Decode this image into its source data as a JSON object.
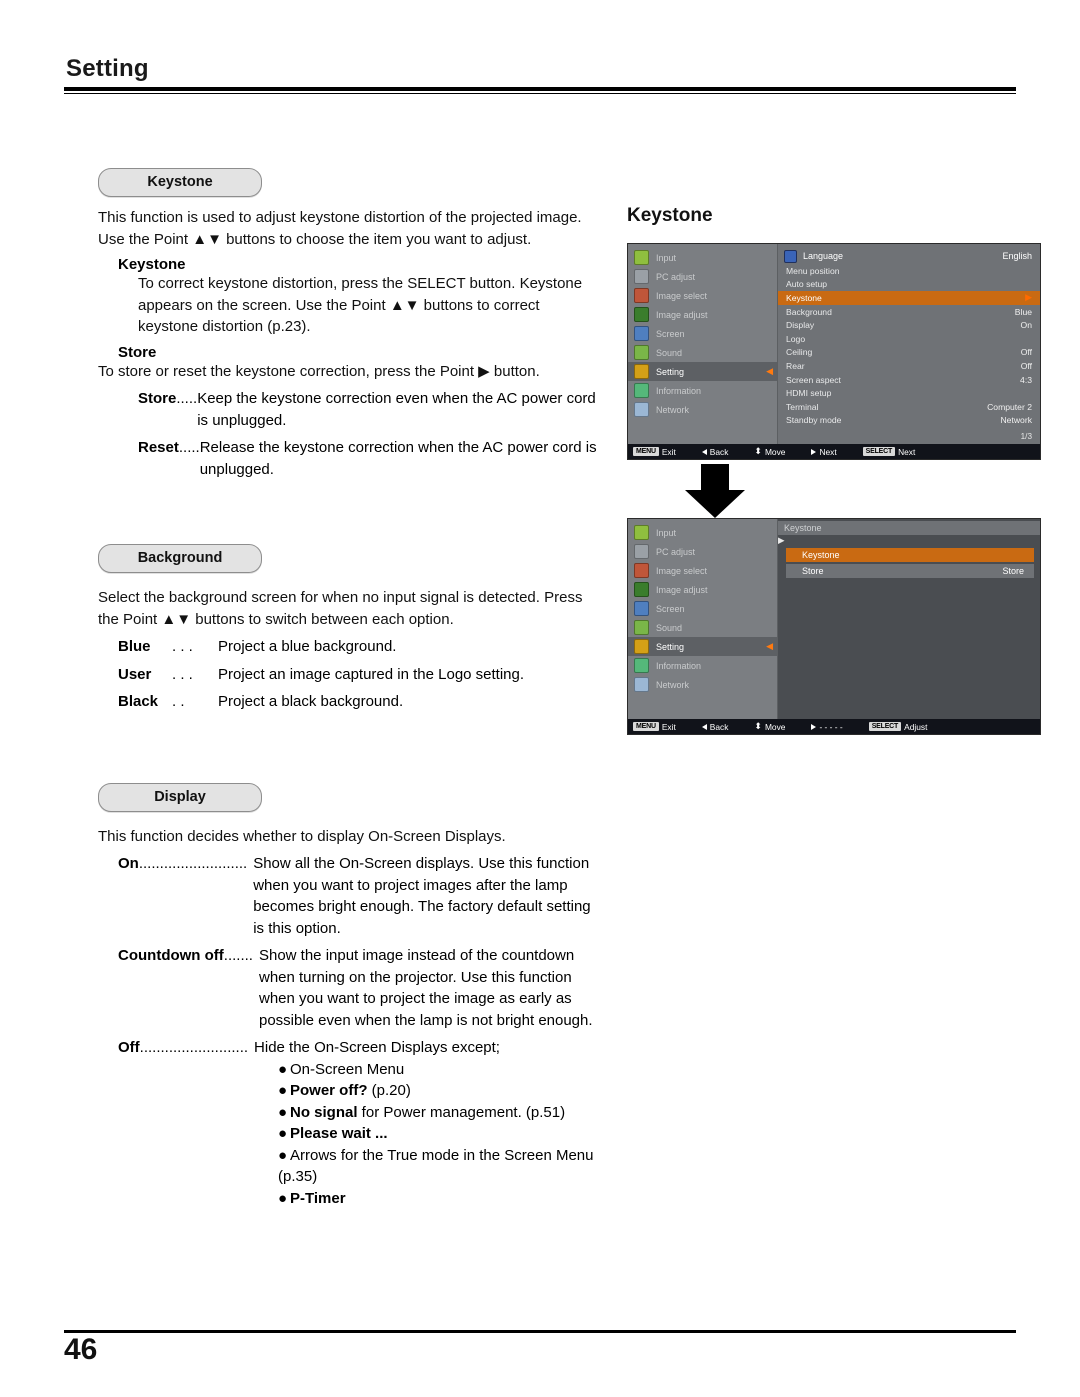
{
  "page": {
    "section_title": "Setting",
    "page_number": "46"
  },
  "keystone": {
    "pill": "Keystone",
    "intro": "This function is used to adjust keystone distortion of the projected image. Use the Point ▲▼ buttons to choose the item you want to adjust.",
    "sub1_title": "Keystone",
    "sub1_text": "To correct keystone distortion, press the SELECT button. Keystone appears on the screen. Use the Point ▲▼ buttons to correct keystone distortion (p.23).",
    "sub2_title": "Store",
    "sub2_text": "To store or reset the keystone correction, press the Point ▶ button.",
    "items": [
      {
        "term": "Store",
        "dots": " .....",
        "desc": "Keep the keystone correction even when the AC power cord is unplugged."
      },
      {
        "term": "Reset",
        "dots": ".....",
        "desc": "Release the keystone correction when the AC power cord is unplugged."
      }
    ]
  },
  "background": {
    "pill": "Background",
    "intro": "Select the background screen for when no input signal is detected. Press the Point ▲▼ buttons to switch between each option.",
    "items": [
      {
        "term": "Blue",
        "dots": " . . .",
        "desc": "Project a blue background."
      },
      {
        "term": "User",
        "dots": " . . .",
        "desc": "Project an image captured in the Logo setting."
      },
      {
        "term": "Black",
        "dots": " . .",
        "desc": "Project a black background."
      }
    ]
  },
  "display": {
    "pill": "Display",
    "intro": "This function decides whether to display On-Screen Displays.",
    "items": [
      {
        "term": "On",
        "dots": " ..........................",
        "desc": "Show all the On-Screen displays. Use this function when you want to project images after the lamp becomes bright enough. The factory default setting is this option."
      },
      {
        "term": "Countdown off",
        "dots": " .......",
        "desc": "Show the input image instead of the countdown when turning on the projector. Use this function when you want to project the image as early as possible even when the lamp is not bright enough."
      },
      {
        "term": "Off",
        "dots": " ..........................",
        "desc": "Hide the On-Screen Displays except;"
      }
    ],
    "off_bullets": [
      {
        "text": "On-Screen Menu",
        "bold": ""
      },
      {
        "text": " (p.20)",
        "bold": "Power off?"
      },
      {
        "text": " for Power management. (p.51)",
        "bold": "No signal"
      },
      {
        "text": "",
        "bold": "Please wait ..."
      },
      {
        "text": "Arrows for the True mode in the Screen Menu (p.35)",
        "bold": ""
      },
      {
        "text": "",
        "bold": "P-Timer"
      }
    ]
  },
  "osd_figure": {
    "title": "Keystone",
    "menu1": {
      "sidebar": [
        {
          "label": "Input",
          "color": "#8fbf3f",
          "active": false
        },
        {
          "label": "PC adjust",
          "color": "#9aa0a6",
          "active": false
        },
        {
          "label": "Image select",
          "color": "#c0563a",
          "active": false
        },
        {
          "label": "Image adjust",
          "color": "#3a7d2c",
          "active": false
        },
        {
          "label": "Screen",
          "color": "#4f7fc0",
          "active": false
        },
        {
          "label": "Sound",
          "color": "#7ab648",
          "active": false
        },
        {
          "label": "Setting",
          "color": "#d4a017",
          "active": true
        },
        {
          "label": "Information",
          "color": "#55b87a",
          "active": false
        },
        {
          "label": "Network",
          "color": "#9bb7d4",
          "active": false
        }
      ],
      "header": "Language",
      "header_value": "English",
      "rows": [
        {
          "label": "Menu position",
          "value": "",
          "selected": false
        },
        {
          "label": "Auto setup",
          "value": "",
          "selected": false
        },
        {
          "label": "Keystone",
          "value": "",
          "selected": true
        },
        {
          "label": "Background",
          "value": "Blue",
          "selected": false
        },
        {
          "label": "Display",
          "value": "On",
          "selected": false
        },
        {
          "label": "Logo",
          "value": "",
          "selected": false
        },
        {
          "label": "Ceiling",
          "value": "Off",
          "selected": false
        },
        {
          "label": "Rear",
          "value": "Off",
          "selected": false
        },
        {
          "label": "Screen aspect",
          "value": "4:3",
          "selected": false
        },
        {
          "label": "HDMI setup",
          "value": "",
          "selected": false
        },
        {
          "label": "Terminal",
          "value": "Computer 2",
          "selected": false
        },
        {
          "label": "Standby mode",
          "value": "Network",
          "selected": false
        }
      ],
      "page_indicator": "1/3",
      "bar": [
        {
          "key": "MENU",
          "label": "Exit"
        },
        {
          "key": "",
          "label": "Back"
        },
        {
          "key": "",
          "label": "Move"
        },
        {
          "key": "",
          "label": "Next"
        },
        {
          "key": "SELECT",
          "label": "Next"
        }
      ]
    },
    "menu2": {
      "sidebar": [
        {
          "label": "Input",
          "color": "#8fbf3f",
          "active": false
        },
        {
          "label": "PC adjust",
          "color": "#9aa0a6",
          "active": false
        },
        {
          "label": "Image select",
          "color": "#c0563a",
          "active": false
        },
        {
          "label": "Image adjust",
          "color": "#3a7d2c",
          "active": false
        },
        {
          "label": "Screen",
          "color": "#4f7fc0",
          "active": false
        },
        {
          "label": "Sound",
          "color": "#7ab648",
          "active": false
        },
        {
          "label": "Setting",
          "color": "#d4a017",
          "active": true
        },
        {
          "label": "Information",
          "color": "#55b87a",
          "active": false
        },
        {
          "label": "Network",
          "color": "#9bb7d4",
          "active": false
        }
      ],
      "title": "Keystone",
      "rows": [
        {
          "label": "Keystone",
          "value": "",
          "selected": true
        },
        {
          "label": "Store",
          "value": "Store",
          "selected": false
        }
      ],
      "bar": [
        {
          "key": "MENU",
          "label": "Exit"
        },
        {
          "key": "",
          "label": "Back"
        },
        {
          "key": "",
          "label": "Move"
        },
        {
          "key": "",
          "label": "- - - - -"
        },
        {
          "key": "SELECT",
          "label": "Adjust"
        }
      ]
    }
  }
}
